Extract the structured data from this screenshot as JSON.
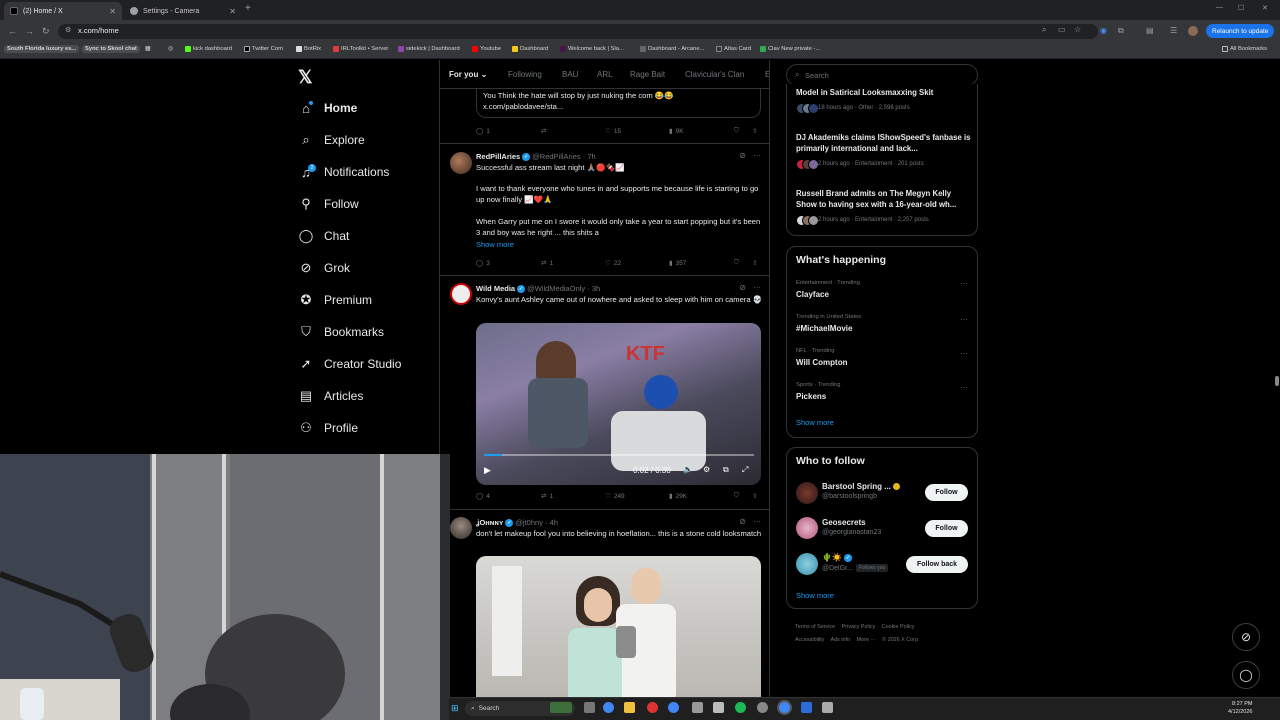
{
  "browser": {
    "tabs": [
      {
        "title": "(2) Home / X",
        "active": true
      },
      {
        "title": "Settings - Camera",
        "active": false
      }
    ],
    "url": "x.com/home",
    "relaunch_label": "Relaunch to update",
    "bookmarks": [
      "South Florida luxury es...",
      "Sync to Skool chat",
      "kick dashboard",
      "Twitter Com",
      "BotRix",
      "IRLToolkit • Server",
      "sidekick | Dashboard",
      "Youtube",
      "Dashboard",
      "Welcome back | Sla...",
      "Dashboard - Arcane...",
      "Atlas Card",
      "Clav New private -...",
      "All Bookmarks"
    ]
  },
  "nav": {
    "items": [
      {
        "label": "Home",
        "icon": "home-icon"
      },
      {
        "label": "Explore",
        "icon": "search-icon"
      },
      {
        "label": "Notifications",
        "icon": "bell-icon",
        "badge": "2"
      },
      {
        "label": "Follow",
        "icon": "follow-icon"
      },
      {
        "label": "Chat",
        "icon": "chat-icon"
      },
      {
        "label": "Grok",
        "icon": "grok-icon"
      },
      {
        "label": "Premium",
        "icon": "premium-icon"
      },
      {
        "label": "Bookmarks",
        "icon": "bookmark-icon"
      },
      {
        "label": "Creator Studio",
        "icon": "rocket-icon"
      },
      {
        "label": "Articles",
        "icon": "article-icon"
      },
      {
        "label": "Profile",
        "icon": "profile-icon"
      }
    ]
  },
  "feed": {
    "tabs": [
      "For you",
      "Following",
      "BAU",
      "ARL",
      "Rage Bait",
      "Clavicular's Clan",
      "E"
    ],
    "quote": {
      "text": "You Think the hate will stop by just nuking the com 😂😂",
      "link": "x.com/pablodavee/sta...",
      "replies": "1",
      "reposts": "",
      "likes": "15",
      "views": "9K"
    },
    "posts": [
      {
        "name": "RedPillAries",
        "handle": "@RedPillAries · 7h",
        "text1": "Successful ass stream last night 🙏🏽🔴🍫📈",
        "text2": "I want to thank everyone who tunes in and supports me because life is starting to go up now finally 📈❤️🙏",
        "text3": "When Garry put me on I swore it would only take a year to start popping but it's been 3 and boy was he right ... this shits a",
        "show_more": "Show more",
        "replies": "3",
        "reposts": "1",
        "likes": "22",
        "views": "357"
      },
      {
        "name": "Wild Media",
        "handle": "@WildMediaOnly · 3h",
        "text1": "Konvy's aunt Ashley came out of nowhere and asked to sleep with him on camera 💀",
        "video_time": "0:02 / 0:30",
        "replies": "4",
        "reposts": "1",
        "likes": "249",
        "views": "29K"
      },
      {
        "name": "ʝOнɴɴʏ",
        "handle": "@jt0hny · 4h",
        "text1": "don't let makeup fool you into believing in hoeflation... this is a stone cold looksmatch"
      }
    ]
  },
  "right": {
    "search_placeholder": "Search",
    "news": [
      {
        "title": "Model in Satirical Looksmaxxing Skit",
        "meta": "18 hours ago · Other · 2,598 posts"
      },
      {
        "title": "DJ Akademiks claims IShowSpeed's fanbase is primarily international and lack...",
        "meta": "2 hours ago · Entertainment · 201 posts"
      },
      {
        "title": "Russell Brand admits on The Megyn Kelly Show to having sex with a 16-year-old wh...",
        "meta": "2 hours ago · Entertainment · 2,257 posts"
      }
    ],
    "happening": {
      "title": "What's happening",
      "trends": [
        {
          "meta": "Entertainment · Trending",
          "name": "Clayface"
        },
        {
          "meta": "Trending in United States",
          "name": "#MichaelMovie"
        },
        {
          "meta": "NFL · Trending",
          "name": "Will Compton"
        },
        {
          "meta": "Sports · Trending",
          "name": "Pickens"
        }
      ],
      "show_more": "Show more"
    },
    "who_to_follow": {
      "title": "Who to follow",
      "users": [
        {
          "name": "Barstool Spring ...",
          "handle": "@barstoolspringb",
          "button": "Follow"
        },
        {
          "name": "Geosecrets",
          "handle": "@georgianastan23",
          "button": "Follow"
        },
        {
          "name": "🌵☀️",
          "handle": "@DelGr...",
          "follows_you": "Follows you",
          "button": "Follow back"
        }
      ],
      "show_more": "Show more"
    },
    "footer": [
      "Terms of Service",
      "Privacy Policy",
      "Cookie Policy",
      "Accessibility",
      "Ads info",
      "More ···",
      "© 2026 X Corp."
    ]
  },
  "taskbar": {
    "search_placeholder": "Search",
    "time": "8:27 PM",
    "date": "4/12/2026"
  },
  "colors": {
    "accent": "#1d9bf0",
    "background": "#000000",
    "border": "#2f3336",
    "muted": "#71767b"
  }
}
